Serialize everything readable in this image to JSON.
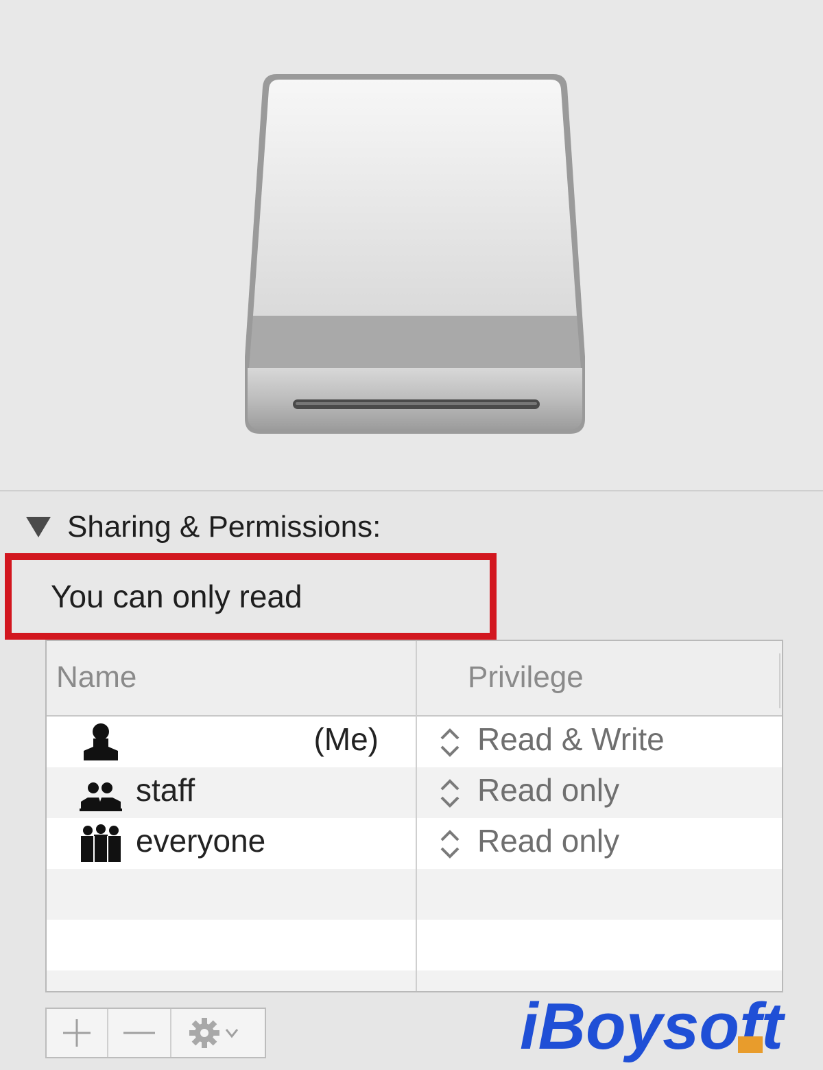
{
  "drive": {
    "icon": "external-drive-icon"
  },
  "section": {
    "title": "Sharing & Permissions:",
    "disclosure_icon": "disclosure-triangle-down-icon"
  },
  "access": {
    "text": "You can only read",
    "highlight_color": "#d2171f"
  },
  "table": {
    "columns": [
      "Name",
      "Privilege"
    ],
    "rows": [
      {
        "icon": "user-icon",
        "name": "(Me)",
        "privilege": "Read & Write"
      },
      {
        "icon": "group-icon",
        "name": "staff",
        "privilege": "Read only"
      },
      {
        "icon": "everyone-icon",
        "name": "everyone",
        "privilege": "Read only"
      }
    ]
  },
  "toolbar": {
    "buttons": [
      {
        "icon": "plus-icon"
      },
      {
        "icon": "minus-icon"
      },
      {
        "icon": "gear-icon"
      }
    ]
  },
  "watermark": {
    "text": "iBoysoft",
    "color": "#1f4fd6"
  }
}
